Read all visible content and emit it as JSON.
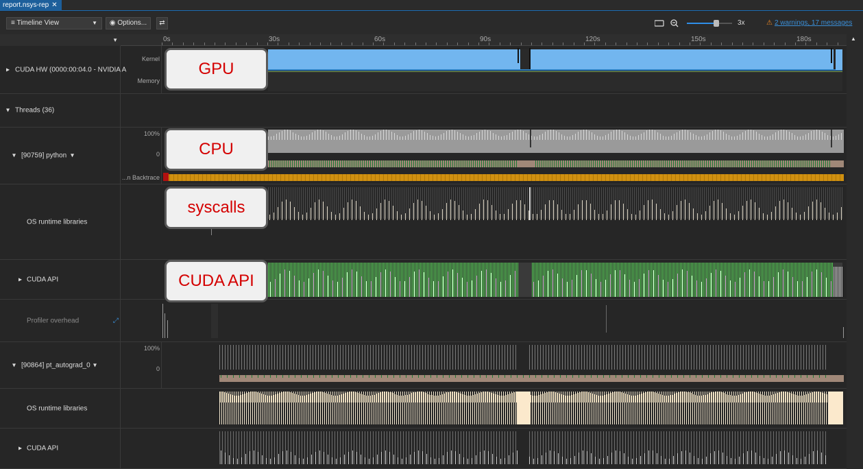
{
  "tab": {
    "title": "report.nsys-rep",
    "close": "✕"
  },
  "toolbar": {
    "view_select": "Timeline View",
    "options_button": "Options...",
    "zoom_value": "3x",
    "warnings_link": "2 warnings, 17 messages"
  },
  "ruler": {
    "ticks": [
      "0s",
      "30s",
      "60s",
      "90s",
      "120s",
      "150s",
      "180s"
    ]
  },
  "rows": {
    "cuda_hw": {
      "label": "CUDA HW (0000:00:04.0 - NVIDIA A",
      "sub_kernel": "Kernel",
      "sub_memory": "Memory"
    },
    "threads": {
      "label": "Threads (36)"
    },
    "python": {
      "label": "[90759] python",
      "pct100": "100%",
      "pct0": "0",
      "backtrace": "...n Backtrace"
    },
    "os_runtime_1": {
      "label": "OS runtime libraries"
    },
    "cuda_api_1": {
      "label": "CUDA API"
    },
    "profiler_overhead": {
      "label": "Profiler overhead"
    },
    "autograd": {
      "label": "[90864] pt_autograd_0",
      "pct100": "100%",
      "pct0": "0"
    },
    "os_runtime_2": {
      "label": "OS runtime libraries"
    },
    "cuda_api_2": {
      "label": "CUDA API"
    }
  },
  "callouts": {
    "gpu": "GPU",
    "cpu": "CPU",
    "syscalls": "syscalls",
    "cuda_api": "CUDA API"
  },
  "colors": {
    "accent": "#1d5f9b",
    "kernel_blue": "#72b6ef",
    "cpu_gray": "#9a9a9a",
    "state_green": "#1f7a35",
    "state_tan": "#a08878",
    "backtrace_orange": "#d09010",
    "cuda_green": "#4fc94f",
    "os_cream": "#f3e7cf",
    "warning_orange": "#f08a24"
  }
}
